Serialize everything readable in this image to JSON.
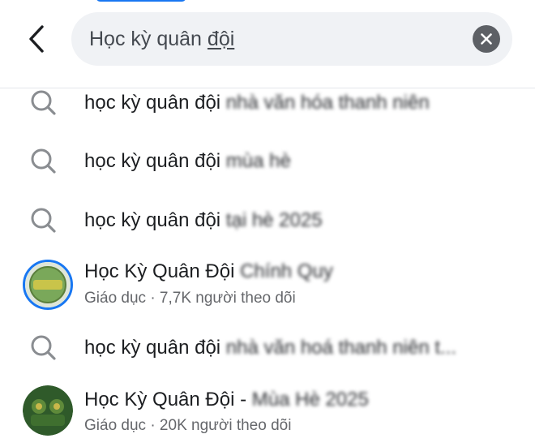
{
  "search": {
    "query_prefix": "Học kỳ quân ",
    "query_underlined": "đội"
  },
  "results": [
    {
      "kind": "query",
      "text": "học kỳ quân đội",
      "blurred": "nhà văn hóa thanh niên"
    },
    {
      "kind": "query",
      "text": "học kỳ quân đội",
      "blurred": "mùa hè"
    },
    {
      "kind": "query",
      "text": "học kỳ quân đội",
      "blurred": "tại hè 2025"
    },
    {
      "kind": "page",
      "title": "Học Kỳ Quân Đội",
      "blurred": "Chính Quy",
      "subtitle": "Giáo dục · 7,7K người theo dõi"
    },
    {
      "kind": "query",
      "text": "học kỳ quân đội",
      "blurred": "nhà văn hoá thanh niên t..."
    },
    {
      "kind": "page",
      "title": "Học Kỳ Quân Đội -",
      "blurred": "Mùa Hè 2025",
      "subtitle": "Giáo dục · 20K người theo dõi"
    }
  ],
  "icons": {
    "back": "chevron-left-icon",
    "clear": "close-circle-icon",
    "suggestion": "search-icon"
  },
  "colors": {
    "accent": "#1877f2",
    "search_bg": "#f0f2f5",
    "secondary_text": "#65676b"
  }
}
